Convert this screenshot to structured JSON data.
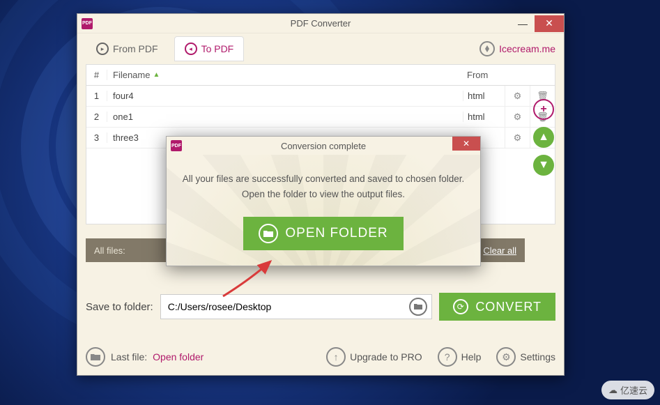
{
  "window": {
    "title": "PDF Converter",
    "icon_label": "PDF"
  },
  "tabs": {
    "from_pdf": "From PDF",
    "to_pdf": "To PDF"
  },
  "brand": {
    "text": "Icecream.me"
  },
  "table": {
    "header_num": "#",
    "header_filename": "Filename",
    "header_from": "From",
    "rows": [
      {
        "num": "1",
        "name": "four4",
        "from": "html"
      },
      {
        "num": "2",
        "name": "one1",
        "from": "html"
      },
      {
        "num": "3",
        "name": "three3",
        "from": ""
      }
    ]
  },
  "allfiles": {
    "label": "All files:",
    "clear": "Clear all"
  },
  "save": {
    "label": "Save to folder:",
    "path": "C:/Users/rosee/Desktop"
  },
  "convert": {
    "label": "CONVERT"
  },
  "footer": {
    "last_file": "Last file:",
    "open_folder": "Open folder",
    "upgrade": "Upgrade to PRO",
    "help": "Help",
    "settings": "Settings"
  },
  "dialog": {
    "title": "Conversion complete",
    "line1": "All your files are successfully converted and saved to chosen folder.",
    "line2": "Open the folder to view the output files.",
    "button": "OPEN FOLDER"
  },
  "watermark": "亿速云"
}
